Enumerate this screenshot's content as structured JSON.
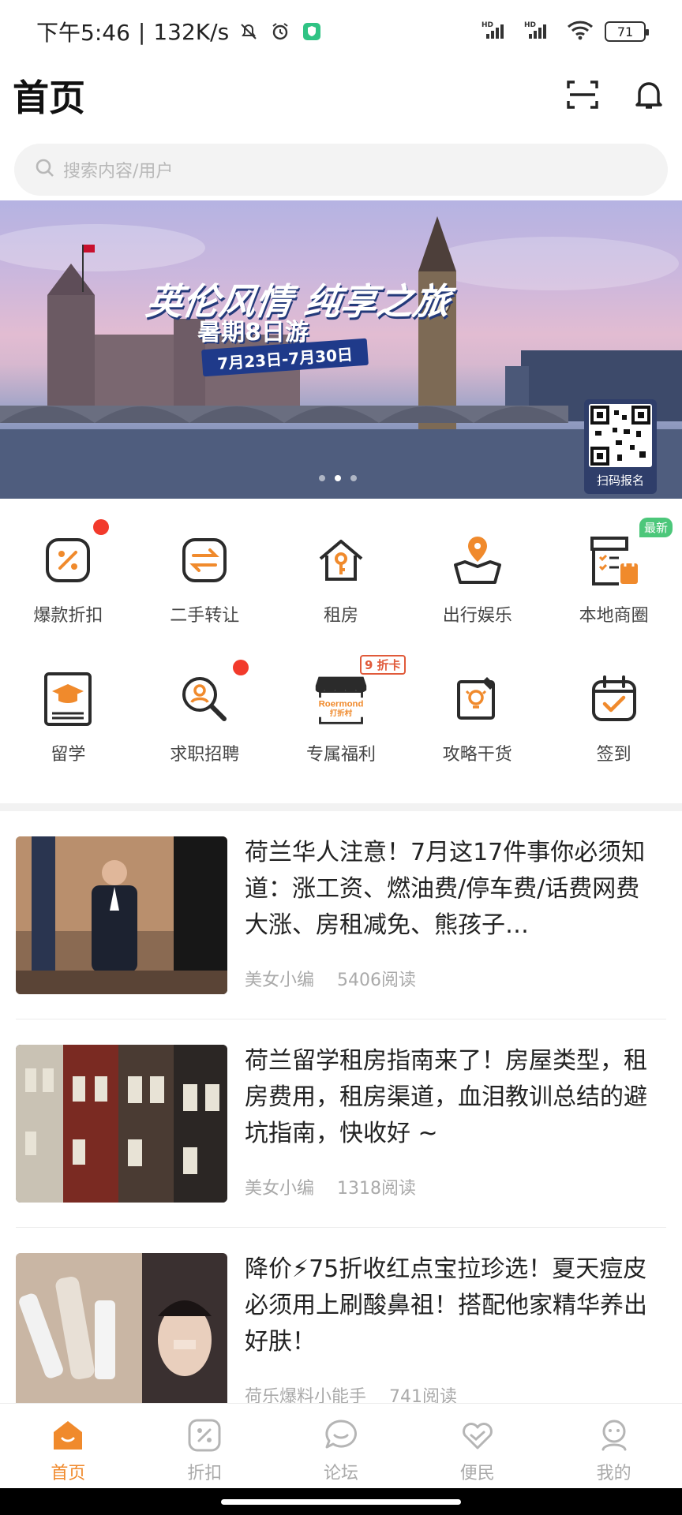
{
  "status": {
    "time": "下午5:46",
    "speed": "132K/s",
    "battery": "71",
    "network": [
      "HD",
      "HD"
    ]
  },
  "header": {
    "title": "首页"
  },
  "search": {
    "placeholder": "搜索内容/用户"
  },
  "banner": {
    "title": "英伦风情 纯享之旅",
    "subtitle": "暑期8日游",
    "date": "7月23日-7月30日",
    "qr_label": "扫码报名",
    "slide_count": 3,
    "active_slide": 2
  },
  "grid": {
    "row1": [
      {
        "label": "爆款折扣",
        "icon": "discount-icon",
        "badge": "red-dot"
      },
      {
        "label": "二手转让",
        "icon": "transfer-icon"
      },
      {
        "label": "租房",
        "icon": "house-key-icon"
      },
      {
        "label": "出行娱乐",
        "icon": "map-pin-icon"
      },
      {
        "label": "本地商圈",
        "icon": "store-list-icon",
        "tag": "最新"
      }
    ],
    "row2": [
      {
        "label": "留学",
        "icon": "graduation-book-icon"
      },
      {
        "label": "求职招聘",
        "icon": "job-search-icon",
        "badge": "red-dot"
      },
      {
        "label": "专属福利",
        "icon": "outlet-shop-icon",
        "tag": "9 折卡",
        "shop_name": "Roermond",
        "shop_sub": "打折村"
      },
      {
        "label": "攻略干货",
        "icon": "guide-bulb-icon"
      },
      {
        "label": "签到",
        "icon": "checkin-calendar-icon"
      }
    ]
  },
  "articles": [
    {
      "title": "荷兰华人注意！7月这17件事你必须知道：涨工资、燃油费/停车费/话费网费大涨、房租减免、熊孩子…",
      "author": "美女小编",
      "reads": "5406阅读"
    },
    {
      "title": "荷兰留学租房指南来了！房屋类型，租房费用，租房渠道，血泪教训总结的避坑指南，快收好 ~",
      "author": "美女小编",
      "reads": "1318阅读"
    },
    {
      "title": "降价⚡75折收红点宝拉珍选！夏天痘皮必须用上刷酸鼻祖！搭配他家精华养出好肤！",
      "author": "荷乐爆料小能手",
      "reads": "741阅读"
    }
  ],
  "tabs": [
    {
      "label": "首页",
      "icon": "home-icon",
      "active": true
    },
    {
      "label": "折扣",
      "icon": "discount-tab-icon"
    },
    {
      "label": "论坛",
      "icon": "forum-icon"
    },
    {
      "label": "便民",
      "icon": "heart-hands-icon"
    },
    {
      "label": "我的",
      "icon": "profile-icon"
    }
  ],
  "colors": {
    "accent": "#f08a2c",
    "icon_dark": "#2b2b2b",
    "badge_red": "#f23a2b",
    "tag_green": "#4cc77a"
  }
}
